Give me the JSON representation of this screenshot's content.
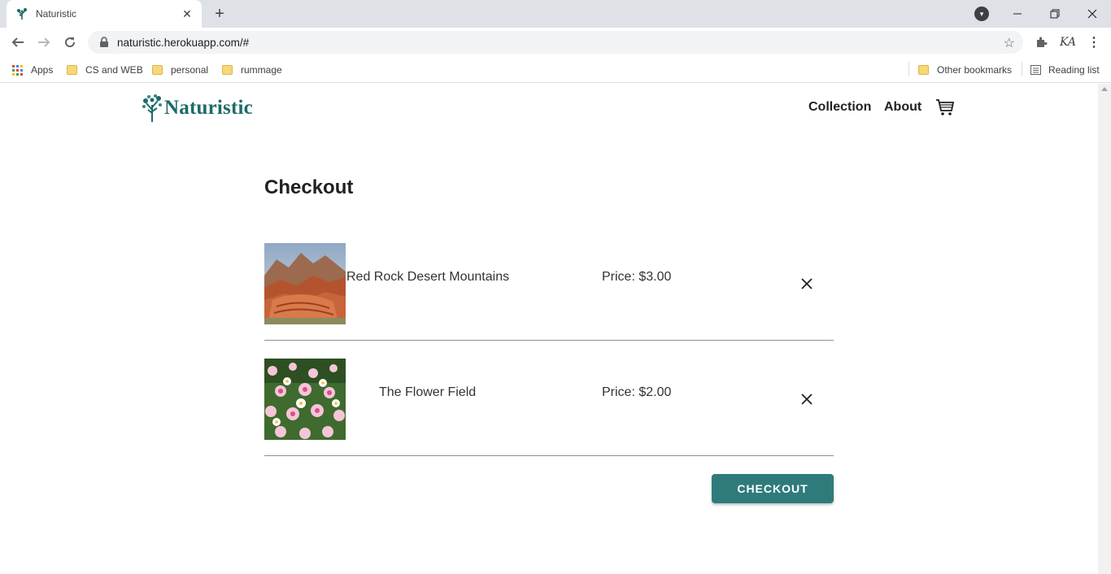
{
  "browser": {
    "tab_title": "Naturistic",
    "url": "naturistic.herokuapp.com/#",
    "profile_label": "KA",
    "bookmarks": [
      "Apps",
      "CS and WEB",
      "personal",
      "rummage"
    ],
    "other_bookmarks": "Other bookmarks",
    "reading_list": "Reading list"
  },
  "site": {
    "logo_text": "Naturistic",
    "nav": [
      "Collection",
      "About"
    ]
  },
  "checkout": {
    "title": "Checkout",
    "items": [
      {
        "name": "Red Rock Desert Mountains",
        "price": "Price: $3.00"
      },
      {
        "name": "The Flower Field",
        "price": "Price: $2.00"
      }
    ],
    "button_label": "CHECKOUT"
  },
  "colors": {
    "accent": "#2f7b7c",
    "logo": "#1d6b67"
  }
}
